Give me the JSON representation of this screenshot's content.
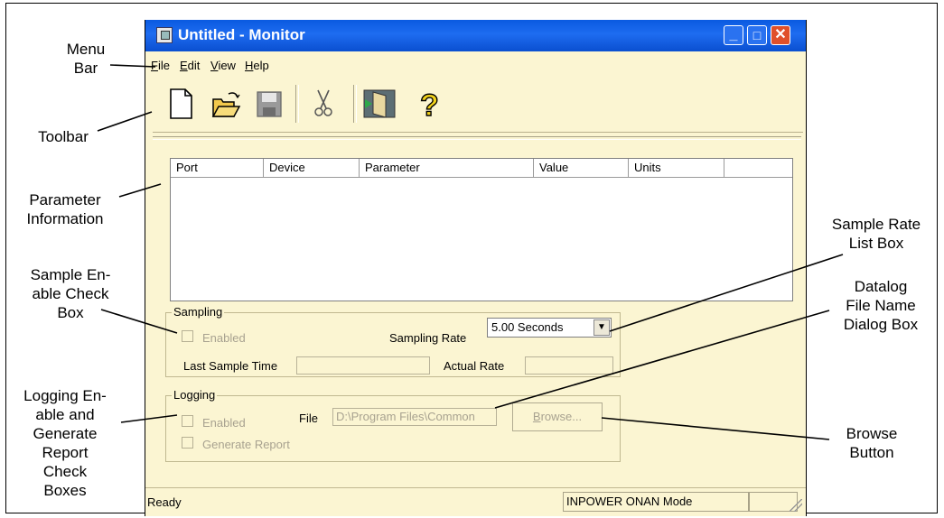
{
  "window": {
    "title": "Untitled - Monitor",
    "minimize_glyph": "_",
    "maximize_glyph": "□",
    "close_glyph": "✕"
  },
  "menu": {
    "file": "ile",
    "file_accel": "F",
    "edit": "dit",
    "edit_accel": "E",
    "view": "iew",
    "view_accel": "V",
    "help": "elp",
    "help_accel": "H"
  },
  "toolbar": {
    "icons": [
      "new-file-icon",
      "open-folder-icon",
      "save-icon",
      "cut-icon",
      "exit-door-icon",
      "help-icon"
    ]
  },
  "list": {
    "columns": [
      "Port",
      "Device",
      "Parameter",
      "Value",
      "Units",
      ""
    ]
  },
  "sampling": {
    "group_label": "Sampling",
    "enabled_label": "Enabled",
    "rate_label": "Sampling Rate",
    "rate_value": "5.00 Seconds",
    "last_sample_label": "Last Sample Time",
    "last_sample_value": "",
    "actual_rate_label": "Actual Rate",
    "actual_rate_value": ""
  },
  "logging": {
    "group_label": "Logging",
    "enabled_label": "Enabled",
    "report_label": "Generate Report",
    "file_label": "File",
    "file_value": "D:\\Program Files\\Common",
    "browse_accel": "B",
    "browse_label": "rowse..."
  },
  "status": {
    "ready": "Ready",
    "mode": "INPOWER ONAN Mode",
    "extra": ""
  },
  "callouts": {
    "menu_bar": "Menu\nBar",
    "toolbar": "Toolbar",
    "parameter_info": "Parameter\nInformation",
    "sample_enable": "Sample En-\nable Check\nBox",
    "logging_enable": "Logging En-\nable and\nGenerate\nReport\nCheck\nBoxes",
    "sample_rate": "Sample Rate\nList Box",
    "datalog": "Datalog\nFile Name\nDialog Box",
    "browse": "Browse\nButton"
  },
  "colors": {
    "window_bg": "#fbf5d2",
    "titlebar": "#0a5ae0",
    "close_button": "#e0502a"
  }
}
